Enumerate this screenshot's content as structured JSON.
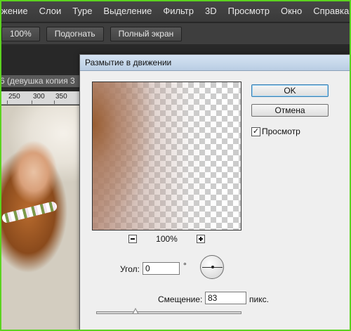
{
  "menubar": {
    "items": [
      {
        "label": "жение"
      },
      {
        "label": "Слои"
      },
      {
        "label": "Type"
      },
      {
        "label": "Выделение"
      },
      {
        "label": "Фильтр"
      },
      {
        "label": "3D"
      },
      {
        "label": "Просмотр"
      },
      {
        "label": "Окно"
      },
      {
        "label": "Справка"
      }
    ]
  },
  "options_bar": {
    "zoom_label": "100%",
    "fit_label": "Подогнать",
    "fullscreen_label": "Полный экран"
  },
  "document": {
    "tab_title": "6 (девушка копия 3",
    "ruler_ticks": [
      "250",
      "300",
      "350"
    ]
  },
  "dialog": {
    "title": "Размытие в движении",
    "ok_label": "OK",
    "cancel_label": "Отмена",
    "preview_label": "Просмотр",
    "preview_checked": true,
    "check_mark": "✓",
    "zoom_level": "100%",
    "angle_label": "Угол:",
    "angle_value": "0",
    "degree_symbol": "°",
    "offset_label": "Смещение:",
    "offset_value": "83",
    "offset_units": "пикс.",
    "offset_slider_fraction": 0.27
  },
  "colors": {
    "frame_accent": "#5bd31f",
    "menubar_bg": "#3c3c3c",
    "dialog_bg": "#efefef"
  }
}
